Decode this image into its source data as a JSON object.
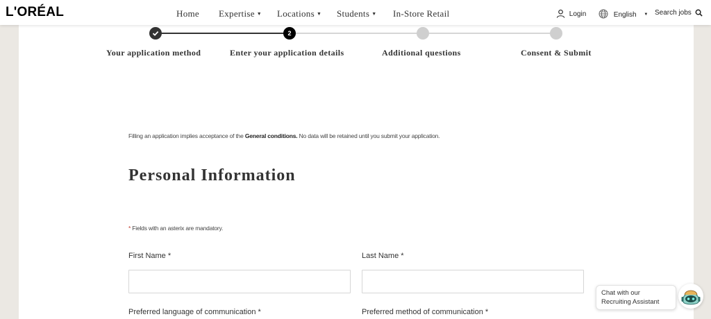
{
  "header": {
    "logo": "L'ORÉAL",
    "nav": [
      {
        "label": "Home",
        "dropdown": false
      },
      {
        "label": "Expertise",
        "dropdown": true
      },
      {
        "label": "Locations",
        "dropdown": true
      },
      {
        "label": "Students",
        "dropdown": true
      },
      {
        "label": "In-Store Retail",
        "dropdown": false
      }
    ],
    "login": "Login",
    "language": "English",
    "search": "Search jobs"
  },
  "stepper": {
    "steps": [
      {
        "label": "Your application method",
        "state": "done"
      },
      {
        "label": "Enter your application details",
        "state": "current",
        "number": "2"
      },
      {
        "label": "Additional questions",
        "state": "todo"
      },
      {
        "label": "Consent & Submit",
        "state": "todo"
      }
    ]
  },
  "form": {
    "notice_prefix": "Filling an application implies acceptance of the ",
    "notice_link": "General conditions.",
    "notice_suffix": " No data will be retained until you submit your application.",
    "section_title": "Personal Information",
    "mandatory_star": "*",
    "mandatory_text": " Fields with an asterix are mandatory.",
    "fields": {
      "first_name": {
        "label": "First Name *",
        "value": ""
      },
      "last_name": {
        "label": "Last Name *",
        "value": ""
      },
      "preferred_language": {
        "label": "Preferred language of communication *"
      },
      "preferred_method": {
        "label": "Preferred method of communication *"
      }
    }
  },
  "chat": {
    "line1": "Chat with our",
    "line2": "Recruiting Assistant"
  },
  "colors": {
    "page_bg": "#ebe8e3",
    "step_done": "#333333",
    "step_todo": "#cfcfcf",
    "required_star": "#c0392b"
  }
}
